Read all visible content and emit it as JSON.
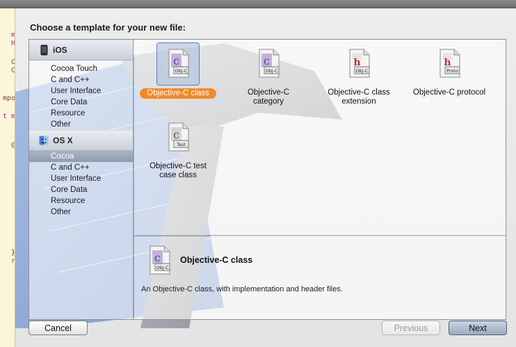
{
  "dialog": {
    "title": "Choose a template for your new file:"
  },
  "editor_gutter": [
    "m",
    "H",
    "C",
    "C",
    "mpo",
    "t m",
    "@",
    "}",
    "r"
  ],
  "sidebar": {
    "sections": [
      {
        "label": "iOS",
        "icon": "iphone-icon",
        "items": [
          "Cocoa Touch",
          "C and C++",
          "User Interface",
          "Core Data",
          "Resource",
          "Other"
        ]
      },
      {
        "label": "OS X",
        "icon": "mac-finder-icon",
        "items": [
          "Cocoa",
          "C and C++",
          "User Interface",
          "Core Data",
          "Resource",
          "Other"
        ]
      }
    ],
    "selected_item": "Cocoa"
  },
  "templates": [
    {
      "label": "Objective-C class",
      "badge": "Obj-C",
      "letter": "c",
      "icon": "objc-class-file-icon",
      "selected": true
    },
    {
      "label": "Objective-C\ncategory",
      "badge": "Obj-C",
      "letter": "c",
      "icon": "objc-category-file-icon",
      "selected": false
    },
    {
      "label": "Objective-C class\nextension",
      "badge": "Obj-C",
      "letter": "h",
      "icon": "objc-extension-file-icon",
      "selected": false
    },
    {
      "label": "Objective-C protocol",
      "badge": "Proto",
      "letter": "h",
      "icon": "objc-protocol-file-icon",
      "selected": false
    },
    {
      "label": "Objective-C test\ncase class",
      "badge": "Test",
      "letter": "c",
      "icon": "objc-test-case-file-icon",
      "selected": false
    }
  ],
  "description": {
    "title": "Objective-C class",
    "badge": "Obj-C",
    "text": "An Objective-C class, with implementation and header files."
  },
  "buttons": {
    "cancel": "Cancel",
    "previous": "Previous",
    "next": "Next"
  },
  "colors": {
    "selection_orange": "#f08a2a",
    "sidebar_selection": "#9aa7b8",
    "header_gradient": "#c9d0d9"
  }
}
